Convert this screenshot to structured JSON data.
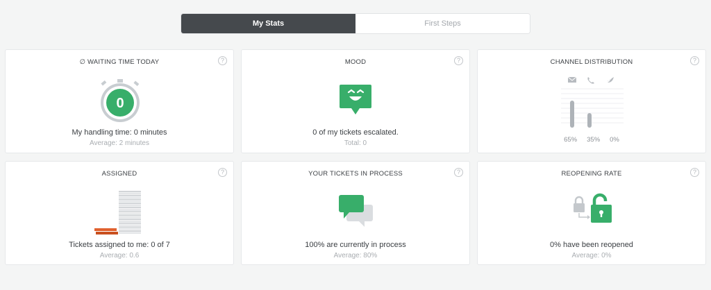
{
  "tabs": [
    {
      "label": "My Stats",
      "active": true
    },
    {
      "label": "First Steps",
      "active": false
    }
  ],
  "colors": {
    "accent_green": "#38ae6a",
    "dark_tab": "#45494d",
    "grey_ring": "#c8cdd1",
    "orange": "#e0602e"
  },
  "cards": {
    "waiting_time": {
      "title": "∅ Waiting time today",
      "value": "0",
      "main": "My handling time: 0 minutes",
      "sub": "Average: 2 minutes"
    },
    "mood": {
      "title": "Mood",
      "main": "0 of my tickets escalated.",
      "sub": "Total: 0"
    },
    "channel": {
      "title": "Channel Distribution",
      "icons": [
        "email-icon",
        "phone-icon",
        "twitter-icon"
      ],
      "percents": [
        "65%",
        "35%",
        "0%"
      ],
      "values": [
        65,
        35,
        0
      ]
    },
    "assigned": {
      "title": "Assigned",
      "main": "Tickets assigned to me: 0 of 7",
      "sub": "Average: 0.6"
    },
    "in_process": {
      "title": "Your tickets in process",
      "main": "100% are currently in process",
      "sub": "Average: 80%"
    },
    "reopening": {
      "title": "Reopening rate",
      "main": "0% have been reopened",
      "sub": "Average: 0%"
    }
  },
  "help_symbol": "?"
}
